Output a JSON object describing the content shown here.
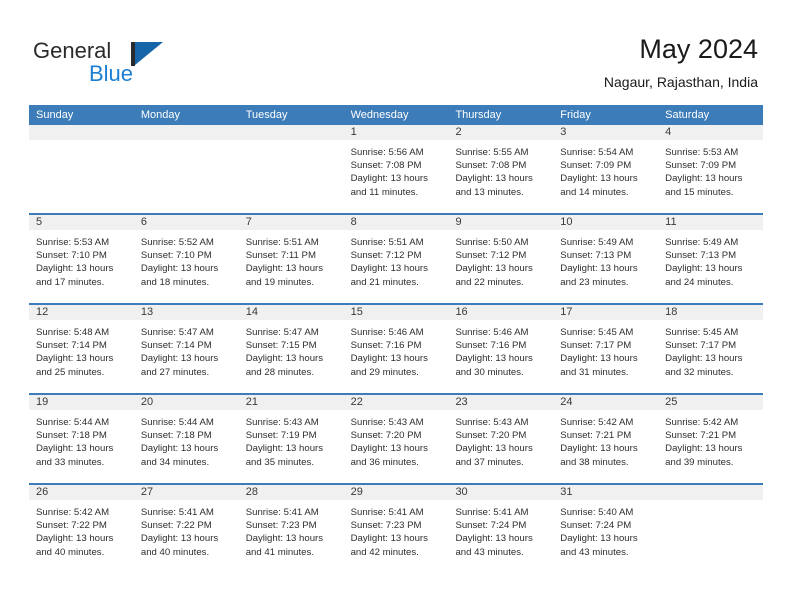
{
  "brand": {
    "name_part1": "General",
    "name_part2": "Blue",
    "flag_icon": "flag-icon",
    "accent_dark": "#2b2b2b",
    "accent_blue": "#1c7fd4"
  },
  "header": {
    "title": "May 2024",
    "location": "Nagaur, Rajasthan, India"
  },
  "theme": {
    "header_blue": "#3c7cb8",
    "date_band_gray": "#f0f0f0",
    "text_color": "#2e2e2e"
  },
  "calendar": {
    "day_headers": [
      "Sunday",
      "Monday",
      "Tuesday",
      "Wednesday",
      "Thursday",
      "Friday",
      "Saturday"
    ],
    "weeks": [
      [
        {
          "day": "",
          "empty": true,
          "lines": []
        },
        {
          "day": "",
          "empty": true,
          "lines": []
        },
        {
          "day": "",
          "empty": true,
          "lines": []
        },
        {
          "day": "1",
          "empty": false,
          "lines": [
            "Sunrise: 5:56 AM",
            "Sunset: 7:08 PM",
            "Daylight: 13 hours",
            "and 11 minutes."
          ]
        },
        {
          "day": "2",
          "empty": false,
          "lines": [
            "Sunrise: 5:55 AM",
            "Sunset: 7:08 PM",
            "Daylight: 13 hours",
            "and 13 minutes."
          ]
        },
        {
          "day": "3",
          "empty": false,
          "lines": [
            "Sunrise: 5:54 AM",
            "Sunset: 7:09 PM",
            "Daylight: 13 hours",
            "and 14 minutes."
          ]
        },
        {
          "day": "4",
          "empty": false,
          "lines": [
            "Sunrise: 5:53 AM",
            "Sunset: 7:09 PM",
            "Daylight: 13 hours",
            "and 15 minutes."
          ]
        }
      ],
      [
        {
          "day": "5",
          "empty": false,
          "lines": [
            "Sunrise: 5:53 AM",
            "Sunset: 7:10 PM",
            "Daylight: 13 hours",
            "and 17 minutes."
          ]
        },
        {
          "day": "6",
          "empty": false,
          "lines": [
            "Sunrise: 5:52 AM",
            "Sunset: 7:10 PM",
            "Daylight: 13 hours",
            "and 18 minutes."
          ]
        },
        {
          "day": "7",
          "empty": false,
          "lines": [
            "Sunrise: 5:51 AM",
            "Sunset: 7:11 PM",
            "Daylight: 13 hours",
            "and 19 minutes."
          ]
        },
        {
          "day": "8",
          "empty": false,
          "lines": [
            "Sunrise: 5:51 AM",
            "Sunset: 7:12 PM",
            "Daylight: 13 hours",
            "and 21 minutes."
          ]
        },
        {
          "day": "9",
          "empty": false,
          "lines": [
            "Sunrise: 5:50 AM",
            "Sunset: 7:12 PM",
            "Daylight: 13 hours",
            "and 22 minutes."
          ]
        },
        {
          "day": "10",
          "empty": false,
          "lines": [
            "Sunrise: 5:49 AM",
            "Sunset: 7:13 PM",
            "Daylight: 13 hours",
            "and 23 minutes."
          ]
        },
        {
          "day": "11",
          "empty": false,
          "lines": [
            "Sunrise: 5:49 AM",
            "Sunset: 7:13 PM",
            "Daylight: 13 hours",
            "and 24 minutes."
          ]
        }
      ],
      [
        {
          "day": "12",
          "empty": false,
          "lines": [
            "Sunrise: 5:48 AM",
            "Sunset: 7:14 PM",
            "Daylight: 13 hours",
            "and 25 minutes."
          ]
        },
        {
          "day": "13",
          "empty": false,
          "lines": [
            "Sunrise: 5:47 AM",
            "Sunset: 7:14 PM",
            "Daylight: 13 hours",
            "and 27 minutes."
          ]
        },
        {
          "day": "14",
          "empty": false,
          "lines": [
            "Sunrise: 5:47 AM",
            "Sunset: 7:15 PM",
            "Daylight: 13 hours",
            "and 28 minutes."
          ]
        },
        {
          "day": "15",
          "empty": false,
          "lines": [
            "Sunrise: 5:46 AM",
            "Sunset: 7:16 PM",
            "Daylight: 13 hours",
            "and 29 minutes."
          ]
        },
        {
          "day": "16",
          "empty": false,
          "lines": [
            "Sunrise: 5:46 AM",
            "Sunset: 7:16 PM",
            "Daylight: 13 hours",
            "and 30 minutes."
          ]
        },
        {
          "day": "17",
          "empty": false,
          "lines": [
            "Sunrise: 5:45 AM",
            "Sunset: 7:17 PM",
            "Daylight: 13 hours",
            "and 31 minutes."
          ]
        },
        {
          "day": "18",
          "empty": false,
          "lines": [
            "Sunrise: 5:45 AM",
            "Sunset: 7:17 PM",
            "Daylight: 13 hours",
            "and 32 minutes."
          ]
        }
      ],
      [
        {
          "day": "19",
          "empty": false,
          "lines": [
            "Sunrise: 5:44 AM",
            "Sunset: 7:18 PM",
            "Daylight: 13 hours",
            "and 33 minutes."
          ]
        },
        {
          "day": "20",
          "empty": false,
          "lines": [
            "Sunrise: 5:44 AM",
            "Sunset: 7:18 PM",
            "Daylight: 13 hours",
            "and 34 minutes."
          ]
        },
        {
          "day": "21",
          "empty": false,
          "lines": [
            "Sunrise: 5:43 AM",
            "Sunset: 7:19 PM",
            "Daylight: 13 hours",
            "and 35 minutes."
          ]
        },
        {
          "day": "22",
          "empty": false,
          "lines": [
            "Sunrise: 5:43 AM",
            "Sunset: 7:20 PM",
            "Daylight: 13 hours",
            "and 36 minutes."
          ]
        },
        {
          "day": "23",
          "empty": false,
          "lines": [
            "Sunrise: 5:43 AM",
            "Sunset: 7:20 PM",
            "Daylight: 13 hours",
            "and 37 minutes."
          ]
        },
        {
          "day": "24",
          "empty": false,
          "lines": [
            "Sunrise: 5:42 AM",
            "Sunset: 7:21 PM",
            "Daylight: 13 hours",
            "and 38 minutes."
          ]
        },
        {
          "day": "25",
          "empty": false,
          "lines": [
            "Sunrise: 5:42 AM",
            "Sunset: 7:21 PM",
            "Daylight: 13 hours",
            "and 39 minutes."
          ]
        }
      ],
      [
        {
          "day": "26",
          "empty": false,
          "lines": [
            "Sunrise: 5:42 AM",
            "Sunset: 7:22 PM",
            "Daylight: 13 hours",
            "and 40 minutes."
          ]
        },
        {
          "day": "27",
          "empty": false,
          "lines": [
            "Sunrise: 5:41 AM",
            "Sunset: 7:22 PM",
            "Daylight: 13 hours",
            "and 40 minutes."
          ]
        },
        {
          "day": "28",
          "empty": false,
          "lines": [
            "Sunrise: 5:41 AM",
            "Sunset: 7:23 PM",
            "Daylight: 13 hours",
            "and 41 minutes."
          ]
        },
        {
          "day": "29",
          "empty": false,
          "lines": [
            "Sunrise: 5:41 AM",
            "Sunset: 7:23 PM",
            "Daylight: 13 hours",
            "and 42 minutes."
          ]
        },
        {
          "day": "30",
          "empty": false,
          "lines": [
            "Sunrise: 5:41 AM",
            "Sunset: 7:24 PM",
            "Daylight: 13 hours",
            "and 43 minutes."
          ]
        },
        {
          "day": "31",
          "empty": false,
          "lines": [
            "Sunrise: 5:40 AM",
            "Sunset: 7:24 PM",
            "Daylight: 13 hours",
            "and 43 minutes."
          ]
        },
        {
          "day": "",
          "empty": true,
          "lines": []
        }
      ]
    ]
  }
}
